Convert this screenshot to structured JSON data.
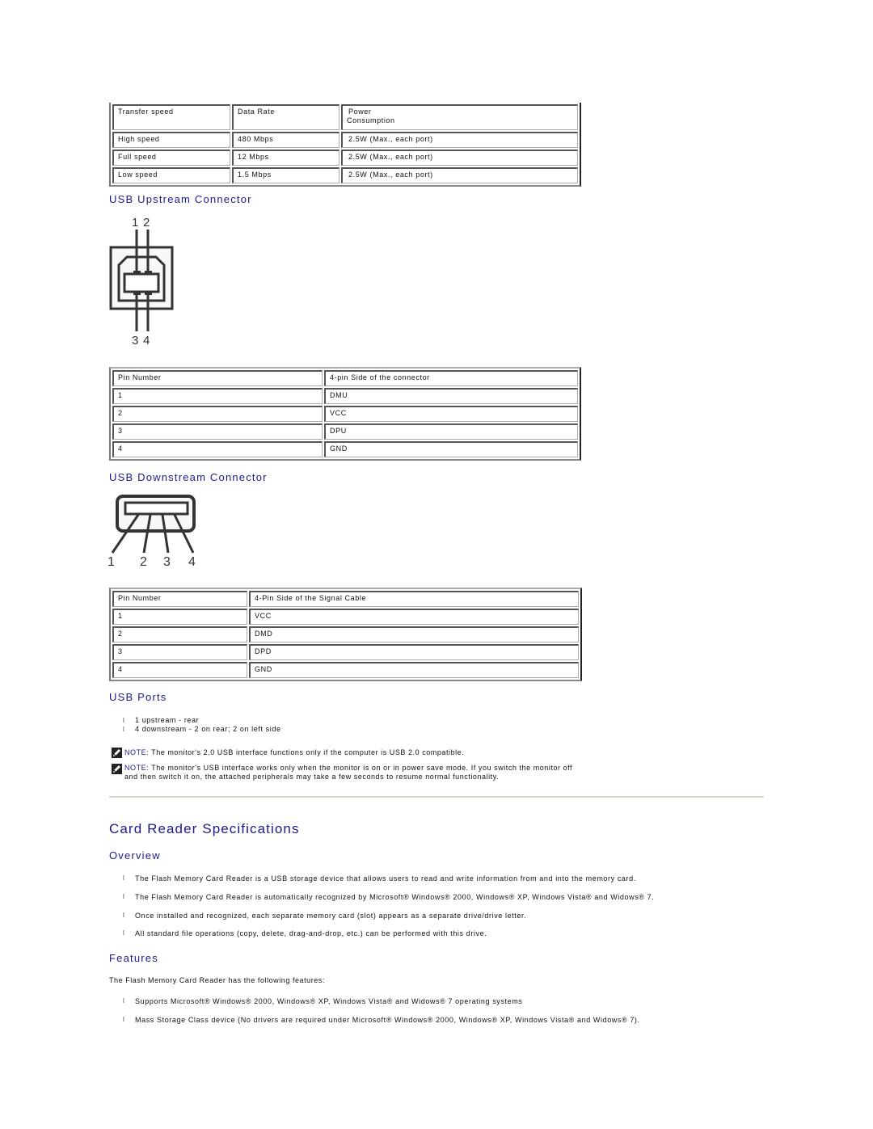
{
  "power_table": {
    "headers": [
      "Transfer speed",
      "Data Rate",
      "Power Consumption"
    ],
    "header_power_line1": "Power",
    "header_power_line2": "Consumption",
    "rows": [
      [
        "High speed",
        "480 Mbps",
        "2.5W (Max., each port)"
      ],
      [
        "Full speed",
        "12 Mbps",
        "2.5W (Max., each port)"
      ],
      [
        "Low speed",
        "1.5 Mbps",
        "2.5W (Max., each port)"
      ]
    ]
  },
  "upstream": {
    "heading": "USB Upstream Connector",
    "diagram_pin_labels": [
      "1",
      "2",
      "3",
      "4"
    ],
    "table": {
      "headers": [
        "Pin Number",
        "4-pin Side of the connector"
      ],
      "rows": [
        [
          "1",
          "DMU"
        ],
        [
          "2",
          "VCC"
        ],
        [
          "3",
          "DPU"
        ],
        [
          "4",
          "GND"
        ]
      ]
    }
  },
  "downstream": {
    "heading": "USB Downstream Connector",
    "diagram_pin_labels": [
      "1",
      "2",
      "3",
      "4"
    ],
    "table": {
      "headers": [
        "Pin Number",
        "4-Pin Side of the Signal Cable"
      ],
      "rows": [
        [
          "1",
          "VCC"
        ],
        [
          "2",
          "DMD"
        ],
        [
          "3",
          "DPD"
        ],
        [
          "4",
          "GND"
        ]
      ]
    }
  },
  "usb_ports": {
    "heading": "USB Ports",
    "items": [
      "1 upstream - rear",
      "4 downstream - 2 on rear; 2 on left side"
    ],
    "notes": [
      {
        "label": "NOTE:",
        "text": " The monitor's 2.0 USB interface functions only if the computer is USB 2.0 compatible."
      },
      {
        "label": "NOTE:",
        "text": " The monitor's USB interface works only when the monitor is on or in power save mode. If you switch the monitor off and then switch it on, the attached peripherals may take a few seconds to resume normal functionality."
      }
    ]
  },
  "card_reader": {
    "title": "Card Reader Specifications",
    "overview": {
      "heading": "Overview",
      "items": [
        "The Flash Memory Card Reader is a USB storage device that allows users to read and write information from and into the memory card.",
        "The Flash Memory Card Reader is automatically recognized by Microsoft® Windows® 2000, Windows® XP, Windows Vista® and Widows® 7.",
        "Once installed and recognized, each separate memory card (slot) appears as a separate drive/drive letter.",
        "All standard file operations (copy, delete, drag-and-drop, etc.) can be performed with this drive."
      ]
    },
    "features": {
      "heading": "Features",
      "intro": "The Flash Memory Card Reader has the following features:",
      "items": [
        "Supports Microsoft® Windows® 2000, Windows® XP, Windows Vista® and Widows® 7 operating systems",
        "Mass Storage Class device (No drivers are required under Microsoft® Windows® 2000, Windows® XP, Windows Vista® and Widows® 7)."
      ]
    }
  },
  "bullet_glyph": "l",
  "colors": {
    "heading": "#1a1a8c",
    "separator": "#d6d6c4"
  }
}
